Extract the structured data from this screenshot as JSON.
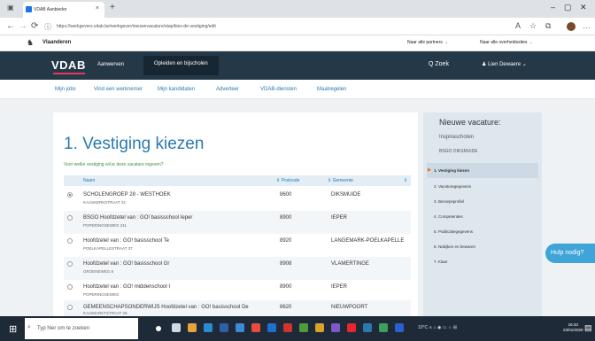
{
  "browser": {
    "tab_title": "VDAB Aanbieder",
    "tab_close": "×",
    "new_tab": "+",
    "url": "https://werkgevers.vdab.be/werkgever/nieuwevacature/stap/kies-de-vestiging/edit",
    "minimize": "–",
    "maximize": "▢",
    "close": "✕",
    "back": "←",
    "forward": "→",
    "reload": "⟳",
    "info": "ⓘ",
    "read_aloud": "A",
    "favorite": "☆",
    "collections": "⧉",
    "more": "…"
  },
  "gov_bar": {
    "site": "Vlaanderen",
    "link1": "Naar alle partners →",
    "link2": "Naar alle overheidssites →"
  },
  "header": {
    "logo": "VDAB",
    "nav": [
      "Aanwerven",
      "Opleiden en bijscholen"
    ],
    "search": "Q  Zoek",
    "user": "Lien Dewaere  ⌄"
  },
  "subnav": [
    "Mijn jobs",
    "Vind een werknemer",
    "Mijn kandidaten",
    "Adverteer",
    "VDAB-diensten",
    "Maatregelen"
  ],
  "main": {
    "title": "1. Vestiging kiezen",
    "question": "Voor welke vestiging wil je deze vacature ingeven?",
    "columns": [
      "Naam",
      "Postcode",
      "Gemeente"
    ],
    "rows": [
      {
        "name": "SCHOLENGROEP 28 - WESTHOEK",
        "address": "KAASKERKSTRAAT 22",
        "postcode": "8600",
        "gemeente": "DIKSMUIDE",
        "selected": true
      },
      {
        "name": "BSGO Hoofdzetel van : GO! basisschool Ieper",
        "address": "POPERINGSEWEG 211",
        "postcode": "8900",
        "gemeente": "IEPER",
        "selected": false
      },
      {
        "name": "Hoofdzetel van : GO! basisschool Te",
        "address": "POELKAPELLESTRAAT 37",
        "postcode": "8920",
        "gemeente": "LANGEMARK-POELKAPELLE",
        "selected": false
      },
      {
        "name": "Hoofdzetel van : GO! basisschool Gr",
        "address": "GROENEWEG 8",
        "postcode": "8908",
        "gemeente": "VLAMERTINGE",
        "selected": false
      },
      {
        "name": "Hoofdzetel van : GO! middenschool I",
        "address": "POPERINGSEWEG",
        "postcode": "8900",
        "gemeente": "IEPER",
        "selected": false
      },
      {
        "name": "GEMEENSCHAPSONDERWIJS Hoofdzetel van : GO! basisschool De",
        "address": "KAAIMARKTSTRAAT 26",
        "postcode": "8620",
        "gemeente": "NIEUWPOORT",
        "selected": false
      }
    ]
  },
  "sidebar": {
    "title": "Nieuwe vacature:",
    "subtitle": "Inspiraschoten",
    "org": "BSGO DIKSMUIDE",
    "steps": [
      "1. Vestiging kiezen",
      "2. Vacaturegegevens",
      "3. Beroepsprofiel",
      "4. Competenties",
      "5. Publicatiegegevens",
      "6. Nakijken en bewaren",
      "7. Klaar"
    ],
    "active_step": 0
  },
  "help_button": "Hulp nodig?",
  "taskbar": {
    "search_placeholder": "Typ hier om te zoeken",
    "tray": "10°C  ∧  ⌂  ◉  ▭  ☼  ⊞",
    "time": "16:43",
    "date": "23/01/2020"
  }
}
